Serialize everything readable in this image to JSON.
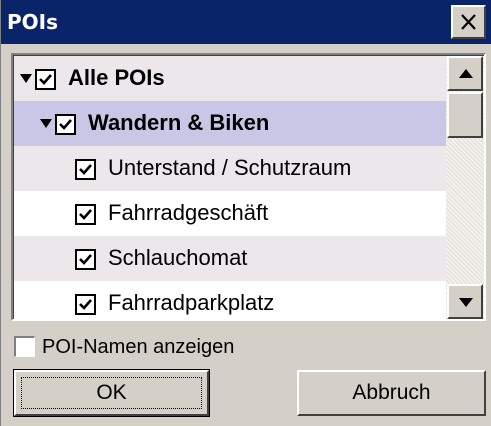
{
  "window": {
    "title": "POIs"
  },
  "tree": {
    "items": [
      {
        "label": "Alle POIs",
        "checked": true,
        "expanded": true,
        "bold": true,
        "level": 0
      },
      {
        "label": "Wandern & Biken",
        "checked": true,
        "expanded": true,
        "bold": true,
        "level": 1,
        "selected": true
      },
      {
        "label": "Unterstand / Schutzraum",
        "checked": true,
        "level": 2
      },
      {
        "label": "Fahrradgeschäft",
        "checked": true,
        "level": 2
      },
      {
        "label": "Schlauchomat",
        "checked": true,
        "level": 2
      },
      {
        "label": "Fahrradparkplatz",
        "checked": true,
        "level": 2
      }
    ]
  },
  "options": {
    "show_names_label": "POI-Namen anzeigen",
    "show_names_checked": false
  },
  "buttons": {
    "ok_label": "OK",
    "cancel_label": "Abbruch"
  },
  "colors": {
    "title_bar": "#0a246a",
    "selection": "#c8c8e6",
    "row_alt": "#ebe7eb",
    "face": "#d4d0c8"
  },
  "icons": {
    "close": "close-icon",
    "expand": "expand-triangle-icon",
    "check": "checkmark-icon",
    "scroll_up": "scroll-up-arrow-icon",
    "scroll_down": "scroll-down-arrow-icon"
  }
}
